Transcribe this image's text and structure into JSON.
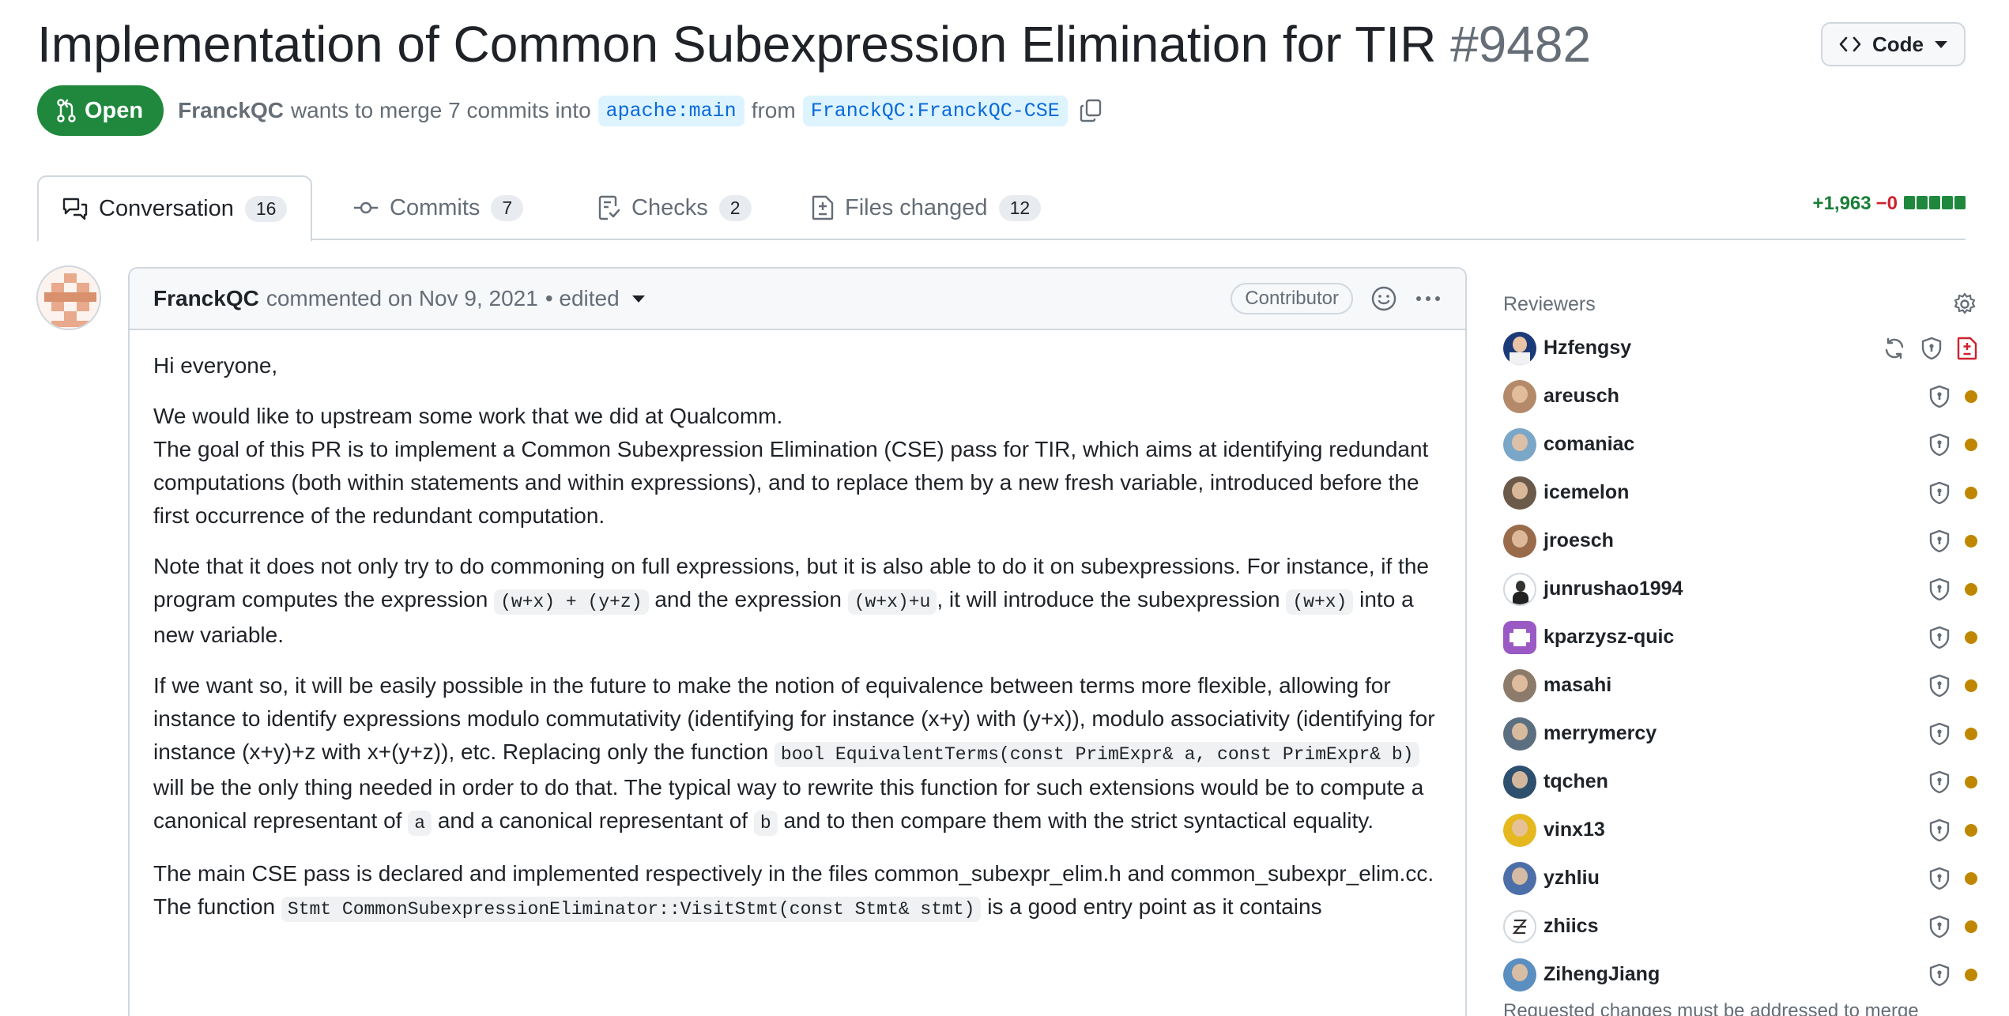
{
  "pr": {
    "title": "Implementation of Common Subexpression Elimination for TIR",
    "number": "#9482",
    "state": "Open",
    "author": "FranckQC",
    "merge_text": "wants to merge 7 commits into",
    "base_branch": "apache:main",
    "from_text": "from",
    "head_branch": "FranckQC:FranckQC-CSE"
  },
  "code_button": {
    "label": "Code"
  },
  "tabs": [
    {
      "label": "Conversation",
      "count": "16"
    },
    {
      "label": "Commits",
      "count": "7"
    },
    {
      "label": "Checks",
      "count": "2"
    },
    {
      "label": "Files changed",
      "count": "12"
    }
  ],
  "diffstat": {
    "additions": "+1,963",
    "deletions": "−0"
  },
  "comment": {
    "author": "FranckQC",
    "action": "commented on Nov 9, 2021",
    "edited": "• edited",
    "role": "Contributor",
    "body": {
      "p1": "Hi everyone,",
      "p2_l1": "We would like to upstream some work that we did at Qualcomm.",
      "p2_l2": "The goal of this PR is to implement a Common Subexpression Elimination (CSE) pass for TIR, which aims at identifying redundant computations (both within statements and within expressions), and to replace them by a new fresh variable, introduced before the first occurrence of the redundant computation.",
      "p3_a": "Note that it does not only try to do commoning on full expressions, but it is also able to do it on subexpressions. For instance, if the program computes the expression",
      "p3_code1": "(w+x) + (y+z)",
      "p3_b": "and the expression",
      "p3_code2": "(w+x)+u",
      "p3_c": ", it will introduce the subexpression",
      "p3_code3": "(w+x)",
      "p3_d": "into a new variable.",
      "p4_a": "If we want so, it will be easily possible in the future to make the notion of equivalence between terms more flexible, allowing for instance to identify expressions modulo commutativity (identifying for instance (x+y) with (y+x)), modulo associativity (identifying for instance (x+y)+z with x+(y+z)), etc. Replacing only the function",
      "p4_code1": "bool EquivalentTerms(const PrimExpr& a, const PrimExpr& b)",
      "p4_b": "will be the only thing needed in order to do that. The typical way to rewrite this function for such extensions would be to compute a canonical representant of",
      "p4_code2": "a",
      "p4_c": "and a canonical representant of",
      "p4_code3": "b",
      "p4_d": "and to then compare them with the strict syntactical equality.",
      "p5_l1": "The main CSE pass is declared and implemented respectively in the files common_subexpr_elim.h and common_subexpr_elim.cc.",
      "p5_a": "The function",
      "p5_code": "Stmt CommonSubexpressionEliminator::VisitStmt(const Stmt& stmt)",
      "p5_b": "is a good entry point as it contains"
    }
  },
  "sidebar": {
    "reviewers_title": "Reviewers",
    "reviewers": [
      {
        "name": "Hzfengsy"
      },
      {
        "name": "areusch"
      },
      {
        "name": "comaniac"
      },
      {
        "name": "icemelon"
      },
      {
        "name": "jroesch"
      },
      {
        "name": "junrushao1994"
      },
      {
        "name": "kparzysz-quic"
      },
      {
        "name": "masahi"
      },
      {
        "name": "merrymercy"
      },
      {
        "name": "tqchen"
      },
      {
        "name": "vinx13"
      },
      {
        "name": "yzhliu"
      },
      {
        "name": "zhiics"
      },
      {
        "name": "ZihengJiang"
      }
    ],
    "note": "Requested changes must be addressed to merge"
  },
  "colors": {
    "open": "#1f883d",
    "link": "#0969da",
    "pending": "#bf8700",
    "changes_requested": "#cf222e"
  }
}
